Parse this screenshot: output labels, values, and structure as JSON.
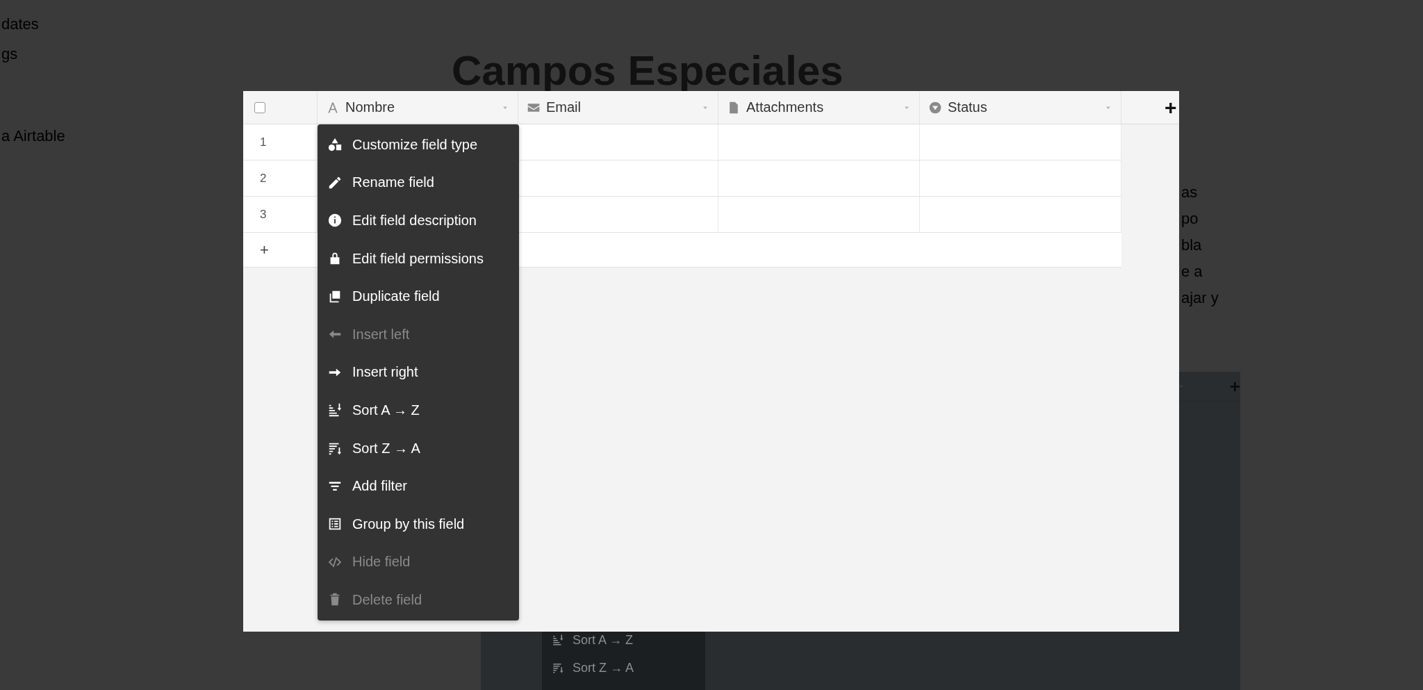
{
  "background_page": {
    "sidebar_items": [
      "dates",
      "gs",
      "a Airtable"
    ],
    "title": "Campos Especiales",
    "paragraph_lines": [
      "as",
      "po",
      "bla",
      "e a",
      "ajar y"
    ],
    "embedded_screenshot": {
      "add_column": "+",
      "menu_items": [
        {
          "label": "Sort A → Z",
          "kind": "sort-asc"
        },
        {
          "label": "Sort Z → A",
          "kind": "sort-desc"
        }
      ]
    }
  },
  "lightbox": {
    "table": {
      "select_all_checked": false,
      "columns": [
        {
          "name": "Nombre",
          "kind": "text"
        },
        {
          "name": "Email",
          "kind": "email"
        },
        {
          "name": "Attachments",
          "kind": "attachment"
        },
        {
          "name": "Status",
          "kind": "select"
        }
      ],
      "add_column": "+",
      "rows": [
        {
          "number": "1"
        },
        {
          "number": "2"
        },
        {
          "number": "3"
        }
      ],
      "add_row": "+"
    },
    "field_menu": {
      "items": [
        {
          "label": "Customize field type",
          "kind": "shapes",
          "disabled": false
        },
        {
          "label": "Rename field",
          "kind": "pencil",
          "disabled": false
        },
        {
          "label": "Edit field description",
          "kind": "info",
          "disabled": false
        },
        {
          "label": "Edit field permissions",
          "kind": "lock",
          "disabled": false
        },
        {
          "label": "Duplicate field",
          "kind": "duplicate",
          "disabled": false
        },
        {
          "label": "Insert left",
          "kind": "arrow-left",
          "disabled": true
        },
        {
          "label": "Insert right",
          "kind": "arrow-right",
          "disabled": false
        },
        {
          "label": "Sort A → Z",
          "kind": "sort-asc",
          "disabled": false
        },
        {
          "label": "Sort Z → A",
          "kind": "sort-desc",
          "disabled": false
        },
        {
          "label": "Add filter",
          "kind": "filter",
          "disabled": false
        },
        {
          "label": "Group by this field",
          "kind": "group",
          "disabled": false
        },
        {
          "label": "Hide field",
          "kind": "hide",
          "disabled": true
        },
        {
          "label": "Delete field",
          "kind": "trash",
          "disabled": true
        }
      ]
    }
  }
}
